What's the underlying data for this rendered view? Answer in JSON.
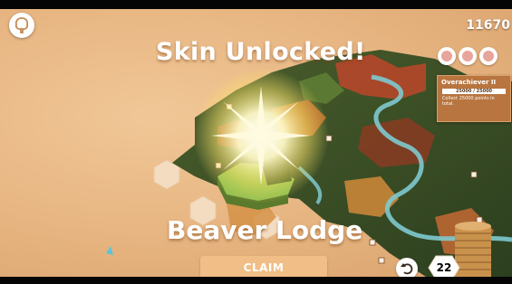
{
  "hud": {
    "tree_icon": "tree-icon",
    "score": "11670"
  },
  "popup": {
    "title": "Skin Unlocked!",
    "skin_name": "Beaver Lodge",
    "claim_label": "CLAIM"
  },
  "achievement": {
    "title": "Overachiever II",
    "progress_text": "25000 / 25000",
    "progress": 1.0,
    "description": "Collect 25000 points in total."
  },
  "badges": [
    "badge-icon",
    "badge-icon",
    "badge-icon"
  ],
  "controls": {
    "undo_icon": "undo-icon",
    "tiles_remaining": "22"
  },
  "colors": {
    "background": "#e8b987",
    "accent_button": "#f0be86",
    "achievement_panel": "#b8753f",
    "forest_dark": "#2f4a25",
    "river": "#7ec9cf"
  }
}
